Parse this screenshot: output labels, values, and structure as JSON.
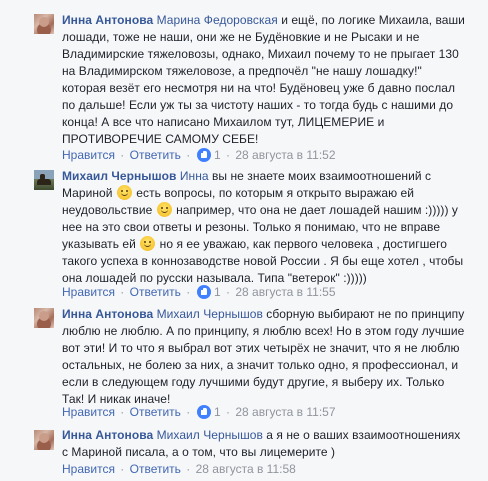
{
  "actions": {
    "like_label": "Нравится",
    "reply_label": "Ответить",
    "separator": "·"
  },
  "comments": [
    {
      "author": "Инна Антонова",
      "mention": "Марина Федоровская",
      "text_1": " и ещё, по логике Михаила, ваши лошади, тоже не наши, они же не Будёновкие и не Рысаки и не Владимирские тяжеловозы, однако, Михаил почему то не прыгает 130 на Владимирском тяжеловозе, а предпочёл \"не нашу лошадку!\" которая везёт его несмотря ни на что! Будёновец уже б давно послал по дальше! Если уж ты за чистоту наших - то тогда будь с нашими до конца! А все что написано Михаилом тут, ЛИЦЕМЕРИЕ и ПРОТИВОРЕЧИЕ САМОМУ СЕБЕ!",
      "likes": "1",
      "date": "28 августа в 11:52"
    },
    {
      "author": "Михаил Чернышов",
      "mention": "Инна",
      "text_1": " вы не знаете моих взаимоотношений с Мариной ",
      "text_2": " есть вопросы, по которым я открыто выражаю ей неудовольствие ",
      "text_3": " например, что она не дает лошадей нашим :))))) у нее на это свои ответы и резоны. Только я понимаю, что не вправе указывать ей ",
      "text_4": " но я ее уважаю, как первого человека , достигшего такого успеха в коннозаводстве новой России . Я бы еще хотел , чтобы она лошадей по русски называла. Типа \"ветерок\" :)))))",
      "likes": "1",
      "date": "28 августа в 11:55"
    },
    {
      "author": "Инна Антонова",
      "mention": "Михаил Чернышов",
      "text_1": " сборную выбирают не по принципу люблю не люблю. А по принципу, я люблю всех! Но в этом году лучшие вот эти! И то что я выбрал вот этих четырёх не значит, что я не люблю остальных, не болею за них, а значит только одно, я профессионал, и если в следующем году лучшими будут другие, я выберу их. Только Так! И никак иначе!",
      "likes": "1",
      "date": "28 августа в 11:57"
    },
    {
      "author": "Инна Антонова",
      "mention": "Михаил Чернышов",
      "text_1": " а я не о ваших взаимоотношениях с Мариной писала, а о том, что вы лицемерите )",
      "date": "28 августа в 11:58"
    }
  ],
  "colors": {
    "link": "#365899",
    "meta": "#90949c",
    "like_badge": "#4080ff",
    "background": "#f6f7f9"
  }
}
